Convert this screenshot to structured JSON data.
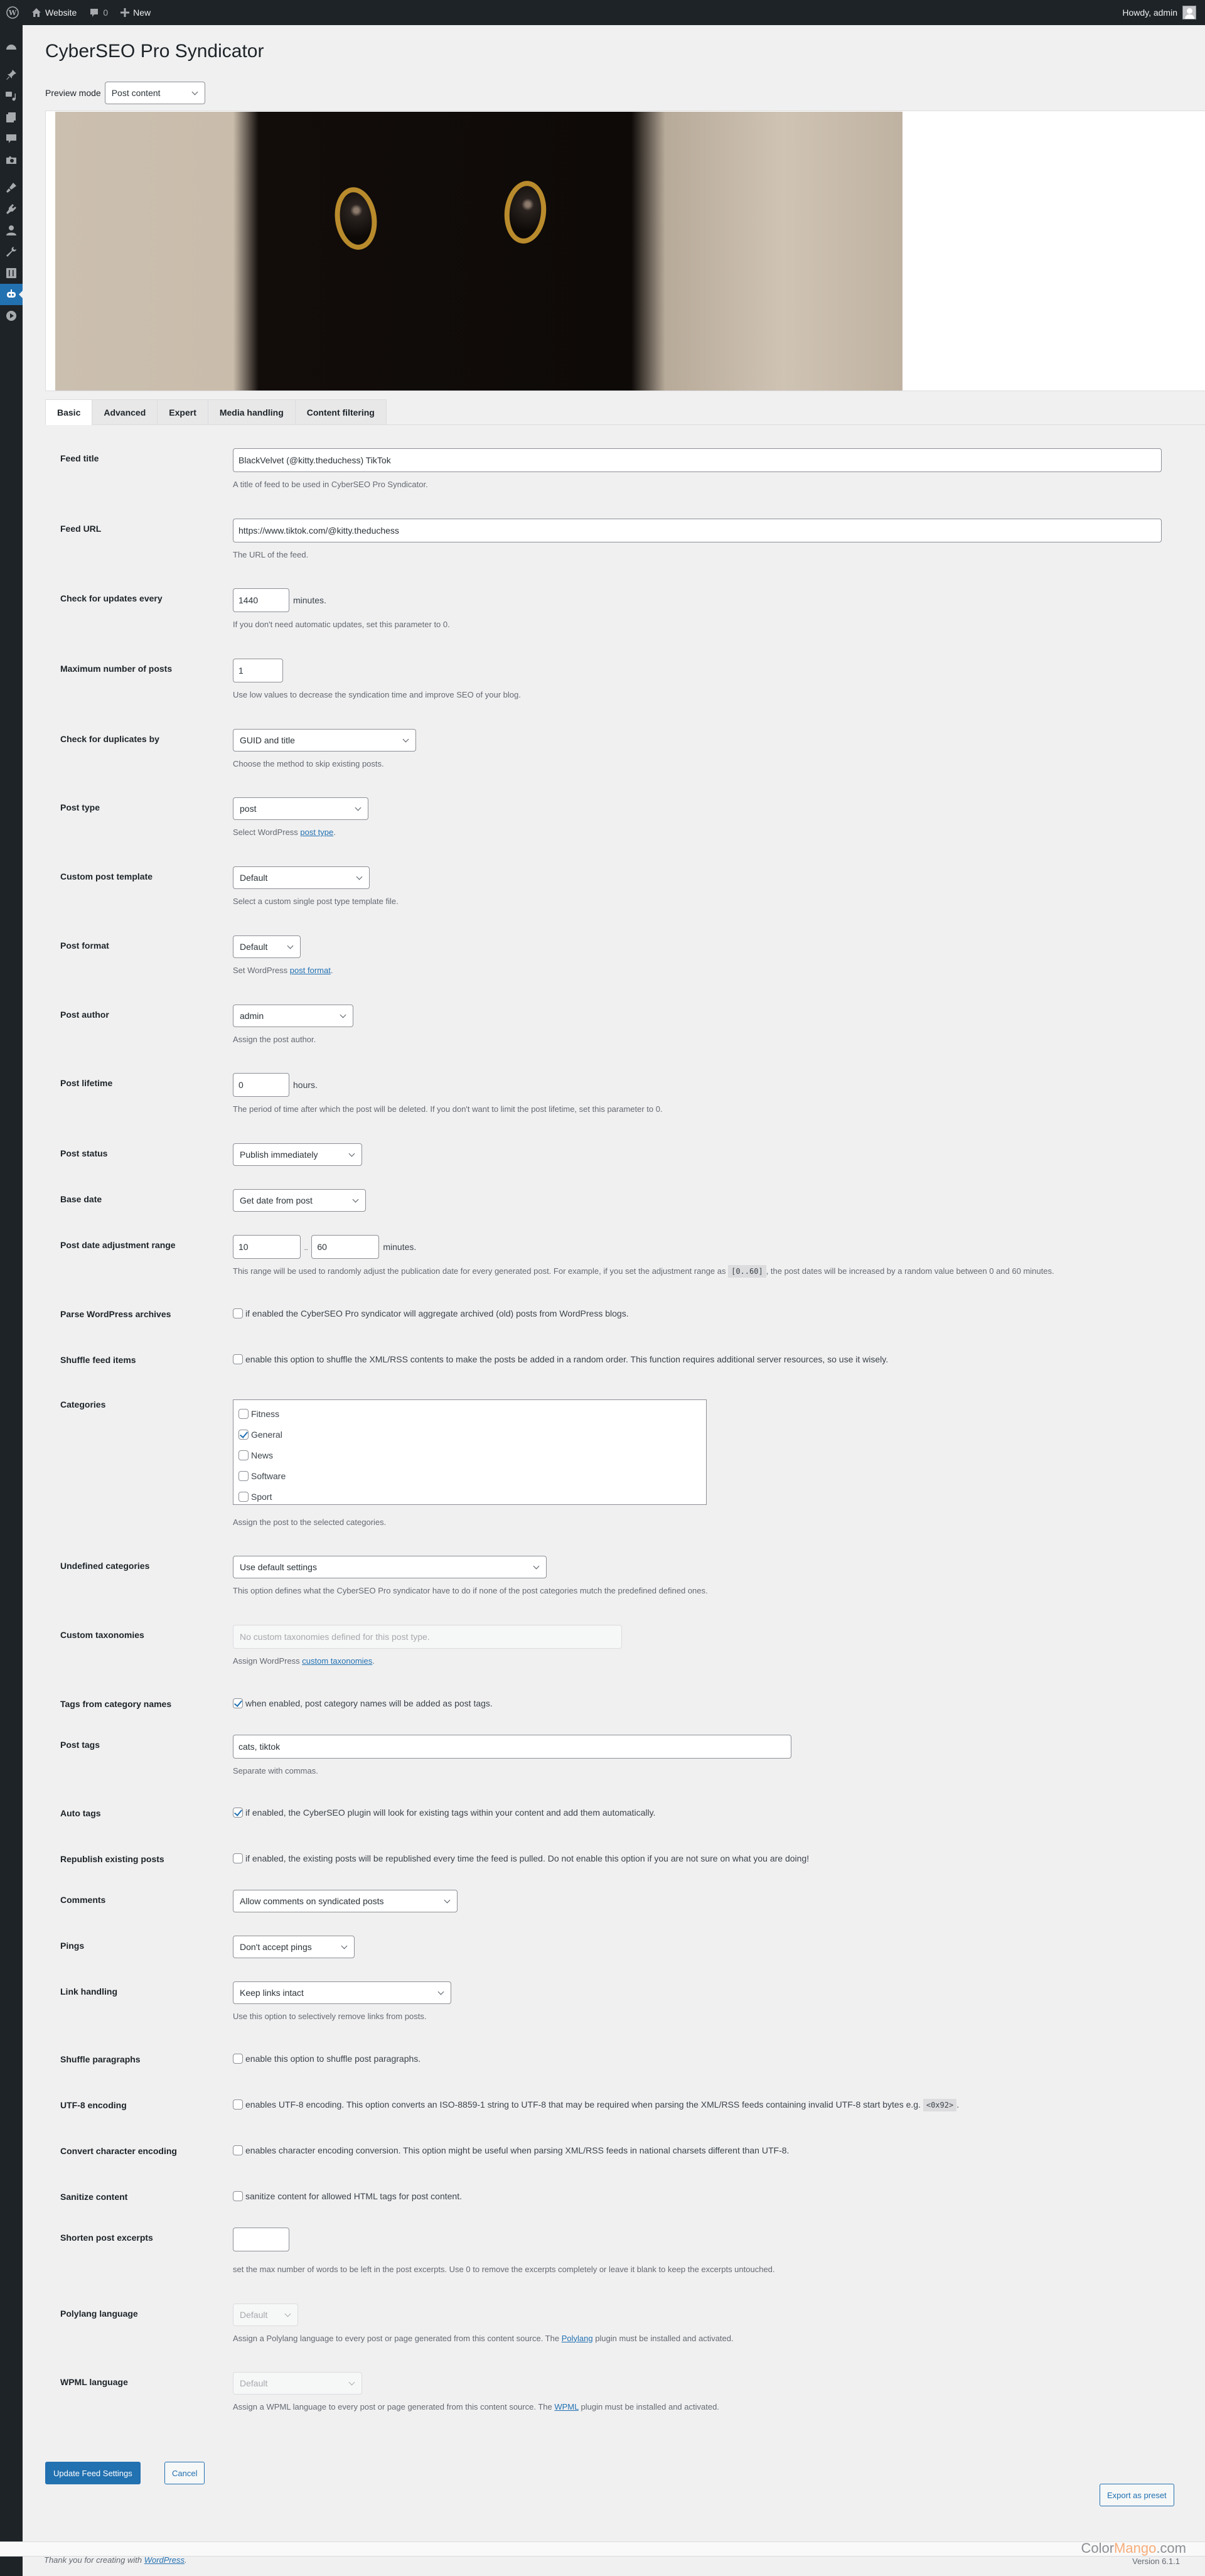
{
  "adminbar": {
    "site_name": "Website",
    "comments_count": "0",
    "new_label": "New",
    "greeting": "Howdy, admin"
  },
  "sidebar": {
    "icons": [
      "dashboard-icon",
      "pin-icon",
      "media-icon",
      "pages-icon",
      "comments-icon",
      "camera-icon",
      "appearance-icon",
      "plugins-icon",
      "users-icon",
      "tools-icon",
      "settings-icon",
      "cyberseo-robot-icon",
      "play-icon"
    ],
    "active": "cyberseo-robot-icon"
  },
  "page": {
    "title": "CyberSEO Pro Syndicator",
    "preview_mode_label": "Preview mode",
    "preview_mode_value": "Post content"
  },
  "tabs": [
    {
      "label": "Basic",
      "active": true
    },
    {
      "label": "Advanced",
      "active": false
    },
    {
      "label": "Expert",
      "active": false
    },
    {
      "label": "Media handling",
      "active": false
    },
    {
      "label": "Content filtering",
      "active": false
    }
  ],
  "form": {
    "feed_title": {
      "label": "Feed title",
      "value": "BlackVelvet (@kitty.theduchess) TikTok",
      "desc": "A title of feed to be used in CyberSEO Pro Syndicator."
    },
    "feed_url": {
      "label": "Feed URL",
      "value": "https://www.tiktok.com/@kitty.theduchess",
      "desc": "The URL of the feed."
    },
    "check_updates": {
      "label": "Check for updates every",
      "value": "1440",
      "unit": "minutes.",
      "desc": "If you don't need automatic updates, set this parameter to 0."
    },
    "max_posts": {
      "label": "Maximum number of posts",
      "value": "1",
      "desc": "Use low values to decrease the syndication time and improve SEO of your blog."
    },
    "duplicates": {
      "label": "Check for duplicates by",
      "value": "GUID and title",
      "desc": "Choose the method to skip existing posts."
    },
    "post_type": {
      "label": "Post type",
      "value": "post",
      "desc_pre": "Select WordPress ",
      "desc_link": "post type",
      "desc_post": "."
    },
    "post_template": {
      "label": "Custom post template",
      "value": "Default",
      "desc": "Select a custom single post type template file."
    },
    "post_format": {
      "label": "Post format",
      "value": "Default",
      "desc_pre": "Set WordPress ",
      "desc_link": "post format",
      "desc_post": "."
    },
    "post_author": {
      "label": "Post author",
      "value": "admin",
      "desc": "Assign the post author."
    },
    "post_lifetime": {
      "label": "Post lifetime",
      "value": "0",
      "unit": "hours.",
      "desc": "The period of time after which the post will be deleted. If you don't want to limit the post lifetime, set this parameter to 0."
    },
    "post_status": {
      "label": "Post status",
      "value": "Publish immediately"
    },
    "base_date": {
      "label": "Base date",
      "value": "Get date from post"
    },
    "date_range": {
      "label": "Post date adjustment range",
      "min": "10",
      "sep": "..",
      "max": "60",
      "unit": "minutes.",
      "desc_pre": "This range will be used to randomly adjust the publication date for every generated post. For example, if you set the adjustment range as ",
      "desc_code": "[0..60]",
      "desc_post": ", the post dates will be increased by a random value between 0 and 60 minutes."
    },
    "parse_archives": {
      "label": "Parse WordPress archives",
      "checked": false,
      "text": "if enabled the CyberSEO Pro syndicator will aggregate archived (old) posts from WordPress blogs."
    },
    "shuffle_items": {
      "label": "Shuffle feed items",
      "checked": false,
      "text": "enable this option to shuffle the XML/RSS contents to make the posts be added in a random order. This function requires additional server resources, so use it wisely."
    },
    "categories": {
      "label": "Categories",
      "items": [
        {
          "name": "Fitness",
          "checked": false
        },
        {
          "name": "General",
          "checked": true
        },
        {
          "name": "News",
          "checked": false
        },
        {
          "name": "Software",
          "checked": false
        },
        {
          "name": "Sport",
          "checked": false
        }
      ],
      "desc": "Assign the post to the selected categories."
    },
    "undefined_categories": {
      "label": "Undefined categories",
      "value": "Use default settings",
      "desc": "This option defines what the CyberSEO Pro syndicator have to do if none of the post categories mutch the predefined defined ones."
    },
    "custom_taxonomies": {
      "label": "Custom taxonomies",
      "placeholder": "No custom taxonomies defined for this post type.",
      "desc_pre": "Assign WordPress ",
      "desc_link": "custom taxonomies",
      "desc_post": "."
    },
    "tags_from_categories": {
      "label": "Tags from category names",
      "checked": true,
      "text": "when enabled, post category names will be added as post tags."
    },
    "post_tags": {
      "label": "Post tags",
      "value": "cats, tiktok",
      "desc": "Separate with commas."
    },
    "auto_tags": {
      "label": "Auto tags",
      "checked": true,
      "text": "if enabled, the CyberSEO plugin will look for existing tags within your content and add them automatically."
    },
    "republish": {
      "label": "Republish existing posts",
      "checked": false,
      "text": "if enabled, the existing posts will be republished every time the feed is pulled. Do not enable this option if you are not sure on what you are doing!"
    },
    "comments": {
      "label": "Comments",
      "value": "Allow comments on syndicated posts"
    },
    "pings": {
      "label": "Pings",
      "value": "Don't accept pings"
    },
    "link_handling": {
      "label": "Link handling",
      "value": "Keep links intact",
      "desc": "Use this option to selectively remove links from posts."
    },
    "shuffle_paragraphs": {
      "label": "Shuffle paragraphs",
      "checked": false,
      "text": "enable this option to shuffle post paragraphs."
    },
    "utf8": {
      "label": "UTF-8 encoding",
      "checked": false,
      "text": "enables UTF-8 encoding. This option converts an ISO-8859-1 string to UTF-8 that may be required when parsing the XML/RSS feeds containing invalid UTF-8 start bytes e.g. ",
      "code": "<0x92>",
      "text_post": "."
    },
    "convert_encoding": {
      "label": "Convert character encoding",
      "checked": false,
      "text": "enables character encoding conversion. This option might be useful when parsing XML/RSS feeds in national charsets different than UTF-8."
    },
    "sanitize": {
      "label": "Sanitize content",
      "checked": false,
      "text": "sanitize content for allowed HTML tags for post content."
    },
    "shorten_excerpts": {
      "label": "Shorten post excerpts",
      "value": "",
      "desc": "set the max number of words to be left in the post excerpts. Use 0 to remove the excerpts completely or leave it blank to keep the excerpts untouched."
    },
    "polylang": {
      "label": "Polylang language",
      "value": "Default",
      "desc_pre": "Assign a Polylang language to every post or page generated from this content source. The ",
      "desc_link": "Polylang",
      "desc_post": " plugin must be installed and activated."
    },
    "wpml": {
      "label": "WPML language",
      "value": "Default",
      "desc_pre": "Assign a WPML language to every post or page generated from this content source. The ",
      "desc_link": "WPML",
      "desc_post": " plugin must be installed and activated."
    }
  },
  "buttons": {
    "update": "Update Feed Settings",
    "cancel": "Cancel",
    "export": "Export as preset"
  },
  "footer": {
    "thanks_pre": "Thank you for creating with ",
    "thanks_link": "WordPress",
    "thanks_post": ".",
    "brand_a": "Color",
    "brand_b": "Mango",
    "brand_c": ".com",
    "version": "Version 6.1.1"
  }
}
